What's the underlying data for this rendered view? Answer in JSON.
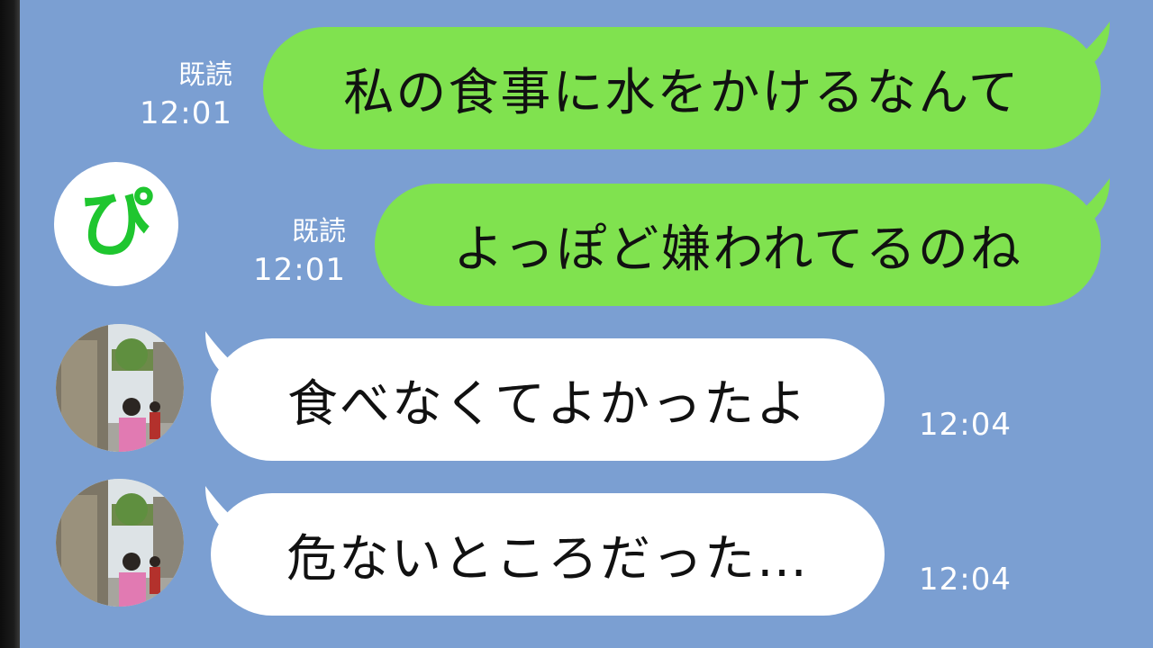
{
  "messages": [
    {
      "direction": "outgoing",
      "text": "私の食事に水をかけるなんて",
      "read": "既読",
      "time": "12:01"
    },
    {
      "direction": "outgoing",
      "text": "よっぽど嫌われてるのね",
      "read": "既読",
      "time": "12:01"
    },
    {
      "direction": "incoming",
      "text": "食べなくてよかったよ",
      "time": "12:04"
    },
    {
      "direction": "incoming",
      "text": "危ないところだった…",
      "time": "12:04"
    }
  ],
  "brand_logo": {
    "text": "ぴ",
    "icon": "pi-logo-icon",
    "color": "#1fc62f"
  },
  "colors": {
    "background": "#7b9fd2",
    "outgoing_bubble": "#80e24f",
    "incoming_bubble": "#ffffff",
    "meta_text": "#ffffff"
  }
}
